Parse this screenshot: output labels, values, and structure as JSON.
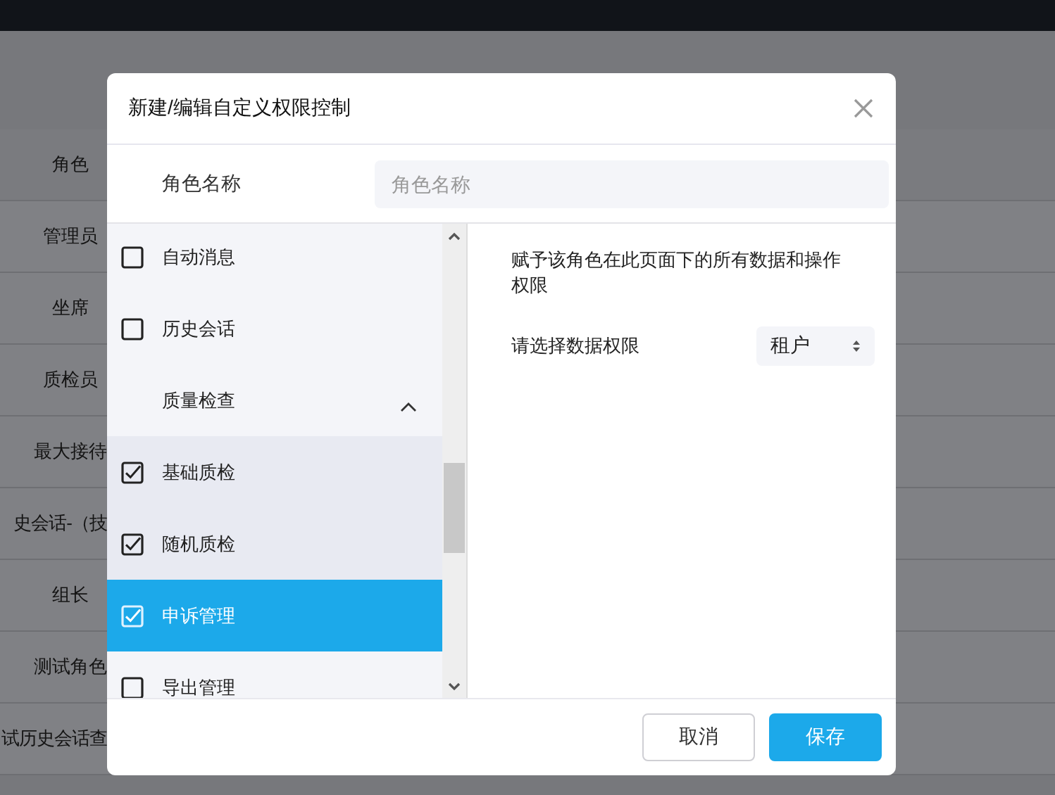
{
  "background_table": {
    "header": "角色",
    "rows": [
      {
        "text": "管理员"
      },
      {
        "text": "坐席"
      },
      {
        "text": "质检员"
      },
      {
        "text": "最大接待"
      },
      {
        "text": "史会话-（技"
      },
      {
        "text": "组长"
      },
      {
        "text": "测试角色"
      },
      {
        "text": "试历史会话查"
      }
    ]
  },
  "dialog": {
    "title": "新建/编辑自定义权限控制",
    "role_name": {
      "label": "角色名称",
      "placeholder": "角色名称"
    },
    "permissions": [
      {
        "kind": "check",
        "label": "自动消息",
        "checked": false,
        "selected": false
      },
      {
        "kind": "check",
        "label": "历史会话",
        "checked": false,
        "selected": false
      },
      {
        "kind": "group",
        "label": "质量检查",
        "expanded": true,
        "children": [
          {
            "kind": "check",
            "label": "基础质检",
            "checked": true,
            "selected": false
          },
          {
            "kind": "check",
            "label": "随机质检",
            "checked": true,
            "selected": false
          },
          {
            "kind": "check",
            "label": "申诉管理",
            "checked": true,
            "selected": true
          }
        ]
      },
      {
        "kind": "check",
        "label": "导出管理",
        "checked": false,
        "selected": false
      }
    ],
    "description": "赋予该角色在此页面下的所有数据和操作权限",
    "data_scope": {
      "label": "请选择数据权限",
      "value": "租户"
    },
    "buttons": [
      {
        "kind": "secondary",
        "label": "取消"
      },
      {
        "kind": "primary",
        "label": "保存"
      }
    ]
  }
}
